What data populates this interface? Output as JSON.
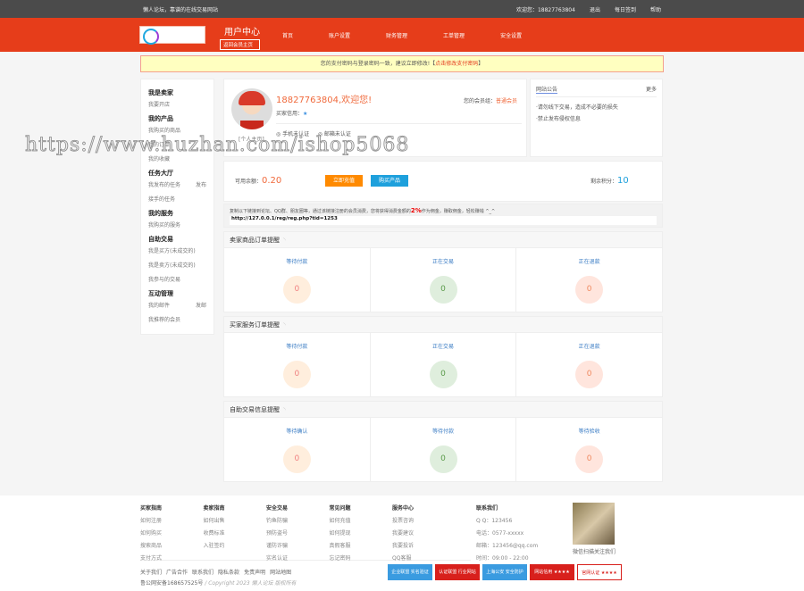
{
  "topbar": {
    "site": "懒人论坛，靠谱的在线交易网站",
    "welcome": "欢迎您：18827763804",
    "logout": "退出",
    "signin": "每日签到",
    "help": "帮助"
  },
  "header": {
    "title": "用户中心",
    "back": "返回会员主页",
    "nav": [
      "首页",
      "账户设置",
      "财务管理",
      "工单管理",
      "安全设置"
    ]
  },
  "notice": {
    "text": "您的支付密码与登录密码一致，建议立即修改!【",
    "link": "点击修改支付密码",
    "end": "】"
  },
  "sidebar": [
    {
      "title": "我是卖家",
      "items": [
        {
          "label": "我要开店"
        }
      ]
    },
    {
      "title": "我的产品",
      "items": [
        {
          "label": "我购买的商品"
        },
        {
          "label": "我的订单"
        },
        {
          "label": "我的收藏"
        }
      ]
    },
    {
      "title": "任务大厅",
      "items": [
        {
          "label": "我发布的任务",
          "extra": "发布"
        },
        {
          "label": "接手的任务"
        }
      ]
    },
    {
      "title": "我的服务",
      "items": [
        {
          "label": "我购买的服务"
        }
      ]
    },
    {
      "title": "自助交易",
      "items": [
        {
          "label": "我是买方(未成交的)"
        },
        {
          "label": "我是卖方(未成交的)"
        },
        {
          "label": "我参与的交易"
        }
      ]
    },
    {
      "title": "互动管理",
      "items": [
        {
          "label": "我的邮件",
          "extra": "发邮"
        },
        {
          "label": "我推荐的会员"
        }
      ]
    }
  ],
  "profile": {
    "greeting": "18827763804,欢迎您!",
    "homepage": "[个人主页]",
    "buyer_credit": "买家信用：",
    "level_label": "您的会员组：",
    "level": "普通会员",
    "phone": "手机未认证",
    "email": "邮箱未认证"
  },
  "announce": {
    "title": "网站公告",
    "more": "更多",
    "items": [
      "·请勿线下交易，造成不必要的损失",
      "·禁止发布侵权信息"
    ]
  },
  "balance": {
    "label": "可用余额：",
    "value": "0.20",
    "recharge": "立即充值",
    "buy": "购买产品",
    "points_label": "剩余积分：",
    "points": "10"
  },
  "invite": {
    "text_a": "复制以下链接到论坛、QQ群、朋友圈等，通过该链接注册的会员消费，您将获得消费金额的",
    "pct": "2%",
    "text_b": "作为佣金，赚取佣金，轻松赚钱 ^_^",
    "url": "http://127.0.0.1/reg/reg.php?tid=1253"
  },
  "sections": [
    {
      "title": "卖家商品订单提醒",
      "cols": [
        {
          "label": "等待付款",
          "value": "0"
        },
        {
          "label": "正在交易",
          "value": "0"
        },
        {
          "label": "正在退款",
          "value": "0"
        }
      ]
    },
    {
      "title": "买家服务订单提醒",
      "cols": [
        {
          "label": "等待付款",
          "value": "0"
        },
        {
          "label": "正在交易",
          "value": "0"
        },
        {
          "label": "正在退款",
          "value": "0"
        }
      ]
    },
    {
      "title": "自助交易信息提醒",
      "cols": [
        {
          "label": "等待确认",
          "value": "0"
        },
        {
          "label": "等待付款",
          "value": "0"
        },
        {
          "label": "等待验收",
          "value": "0"
        }
      ]
    }
  ],
  "footer": {
    "cols": [
      {
        "title": "买家指南",
        "items": [
          "如何注册",
          "如何购买",
          "搜索商品",
          "支付方式"
        ]
      },
      {
        "title": "卖家指南",
        "items": [
          "如何出售",
          "收费标准",
          "入驻签约"
        ]
      },
      {
        "title": "安全交易",
        "items": [
          "钓鱼防骗",
          "预防盗号",
          "谨防诈骗",
          "实名认证"
        ]
      },
      {
        "title": "常见问题",
        "items": [
          "如何充值",
          "如何提现",
          "真假客服",
          "忘记密码"
        ]
      },
      {
        "title": "服务中心",
        "items": [
          "投票咨询",
          "我要建议",
          "我要投诉",
          "QQ客服"
        ]
      }
    ],
    "contact": {
      "title": "联系我们",
      "items": [
        "Q Q：123456",
        "电话：0577-xxxxx",
        "邮箱：123456@qq.com",
        "时间：09:00 - 22:00"
      ]
    },
    "qr_caption": "微信扫描关注我们",
    "links": [
      "关于我们",
      "广告合作",
      "联系我们",
      "隐私条款",
      "免责声明",
      "网站地图"
    ],
    "icp": "鲁公网安备168657525号",
    "copyright": "/ Copyright 2023 懒人论坛 版权所有",
    "badges": [
      "企业联盟 实名验证",
      "认证联盟 行业网站",
      "上海公安 安全防护",
      "网站信用 ★★★★",
      "官网认证 ★★★★"
    ]
  },
  "watermark": "https://www.huzhan.com/ishop5068"
}
